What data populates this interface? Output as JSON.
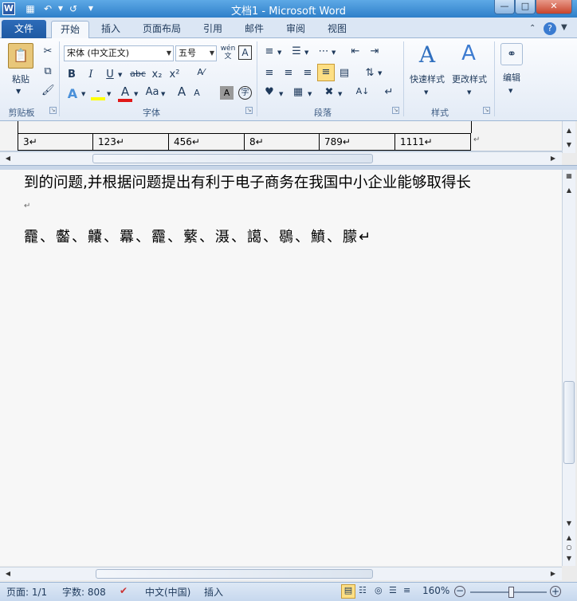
{
  "window": {
    "title": "文档1 - Microsoft Word",
    "app_icon": "W"
  },
  "tabs": [
    {
      "label": "文件"
    },
    {
      "label": "开始"
    },
    {
      "label": "插入"
    },
    {
      "label": "页面布局"
    },
    {
      "label": "引用"
    },
    {
      "label": "邮件"
    },
    {
      "label": "审阅"
    },
    {
      "label": "视图"
    }
  ],
  "ribbon": {
    "clipboard": {
      "paste_label": "粘贴",
      "group_label": "剪贴板"
    },
    "font": {
      "font_name": "宋体 (中文正文)",
      "font_size": "五号",
      "group_label": "字体",
      "bold": "B",
      "italic": "I",
      "underline": "U",
      "strike": "abc",
      "subscript": "x₂",
      "superscript": "x²",
      "wen": "wén 文",
      "a_grow": "A",
      "a_shrink": "A",
      "aa": "Aa"
    },
    "paragraph": {
      "group_label": "段落"
    },
    "styles": {
      "quick_label": "快速样式",
      "change_label": "更改样式",
      "group_label": "样式"
    },
    "editing": {
      "edit_label": "编辑"
    }
  },
  "table_row": [
    "3↵",
    "123↵",
    "456↵",
    "8↵",
    "789↵",
    "1111↵"
  ],
  "document": {
    "line1": "到的问题,并根据问题提出有利于电子商务在我国中小企业能够取得长",
    "para_mark": "↵",
    "line2": "龗、齾、齉、羃、龗、蘩、滠、譪、鶡、鱝、朦↵"
  },
  "status": {
    "page": "页面: 1/1",
    "words": "字数: 808",
    "language": "中文(中国)",
    "insert": "插入",
    "zoom": "160%"
  },
  "colors": {
    "file_tab": "#2d6bb8",
    "title_bar": "#3b8ad6",
    "ribbon_bg": "#e3ebf6"
  }
}
